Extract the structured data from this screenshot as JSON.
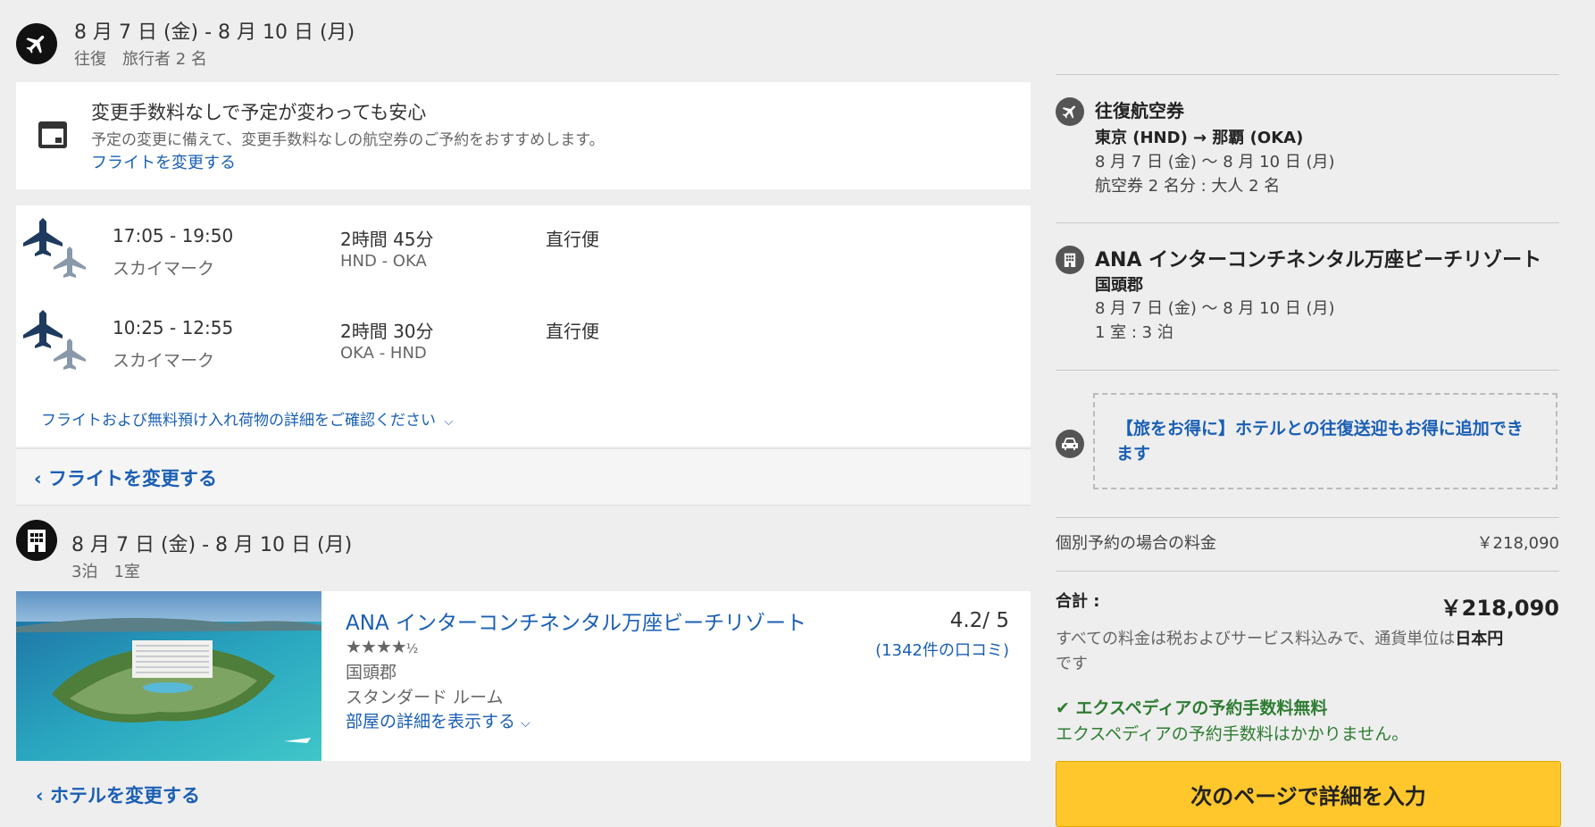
{
  "flight_header": {
    "dates": "8 月 7 日 (金) - 8 月 10 日 (月)",
    "sub": "往復　旅行者 2 名"
  },
  "notice": {
    "title": "変更手数料なしで予定が変わっても安心",
    "desc": "予定の変更に備えて、変更手数料なしの航空券のご予約をおすすめします。",
    "link": "フライトを変更する"
  },
  "flights": [
    {
      "time": "17:05 - 19:50",
      "airline": "スカイマーク",
      "duration": "2時間 45分",
      "route": "HND - OKA",
      "type": "直行便"
    },
    {
      "time": "10:25 - 12:55",
      "airline": "スカイマーク",
      "duration": "2時間 30分",
      "route": "OKA - HND",
      "type": "直行便"
    }
  ],
  "flight_details_link": "フライトおよび無料預け入れ荷物の詳細をご確認ください",
  "change_flight_link": "フライトを変更する",
  "hotel_header": {
    "dates": "8 月 7 日 (金) - 8 月 10 日 (月)",
    "sub": "3泊　1室"
  },
  "hotel": {
    "name": "ANA インターコンチネンタル万座ビーチリゾート",
    "stars": "★★★★",
    "half_star": "½",
    "rating_value": 4.5,
    "location": "国頭郡",
    "room": "スタンダード ルーム",
    "room_link": "部屋の詳細を表示する",
    "rating": "4.2/ 5",
    "reviews": "(1342件の口コミ)"
  },
  "change_hotel_link": "ホテルを変更する",
  "summary": {
    "flight": {
      "title": "往復航空券",
      "route": "東京 (HND) → 那覇 (OKA)",
      "dates": "8 月 7 日 (金) ～ 8 月 10 日 (月)",
      "tickets": "航空券 2 名分 : 大人 2 名"
    },
    "hotel": {
      "title": "ANA インターコンチネンタル万座ビーチリゾート",
      "location": "国頭郡",
      "dates": "8 月 7 日 (金) ～ 8 月 10 日 (月)",
      "rooms": "1 室 : 3 泊"
    },
    "transfer": "【旅をお得に】ホテルとの往復送迎もお得に追加できます",
    "separate_label": "個別予約の場合の料金",
    "separate_price": "￥218,090",
    "total_label": "合計 :",
    "total_price": "￥218,090",
    "tax_note_1": "すべての料金は税およびサービス料込みで、通貨単位は",
    "tax_note_currency": "日本円",
    "tax_note_2": "です",
    "fee_title": "エクスペディアの予約手数料無料",
    "fee_desc": "エクスペディアの予約手数料はかかりません。",
    "cta": "次のページで詳細を入力"
  },
  "colors": {
    "link": "#1a5fb4",
    "cta": "#ffc72c",
    "check": "#2e7d32",
    "plane_dark": "#1f3a5f",
    "plane_light": "#8a99aa"
  }
}
